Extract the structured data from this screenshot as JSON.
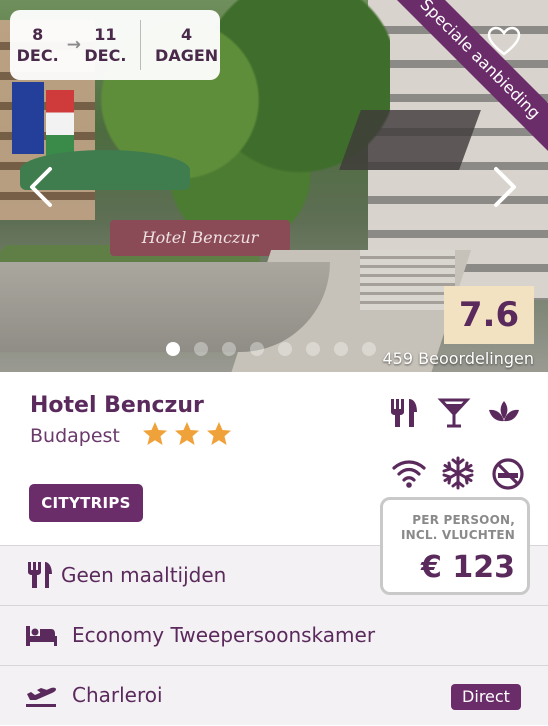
{
  "dates": {
    "start_day": "8",
    "start_month": "DEC.",
    "end_day": "11",
    "end_month": "DEC.",
    "nights_count": "4",
    "nights_label": "DAGEN",
    "arrow": "→"
  },
  "ribbon": "Speciale aanbieding",
  "image": {
    "sign_text": "Hotel Benczur"
  },
  "score": {
    "value": "7.6",
    "reviews": "459 Beoordelingen"
  },
  "carousel": {
    "dot_count": 8,
    "active_index": 0
  },
  "hotel": {
    "name": "Hotel Benczur",
    "city": "Budapest",
    "stars": 3
  },
  "amenities": [
    "restaurant-icon",
    "bar-icon",
    "spa-icon",
    "wifi-icon",
    "air-conditioning-icon",
    "no-smoking-icon"
  ],
  "tag": "CITYTRIPS",
  "price": {
    "label_line1": "PER PERSOON,",
    "label_line2": "INCL. VLUCHTEN",
    "value": "€ 123"
  },
  "details": {
    "board": "Geen maaltijden",
    "room": "Economy Tweepersoonskamer",
    "airport": "Charleroi",
    "flight_type": "Direct"
  },
  "colors": {
    "primary": "#6b2d6a",
    "star": "#f0a23a",
    "score_bg": "#f2e2c2"
  }
}
